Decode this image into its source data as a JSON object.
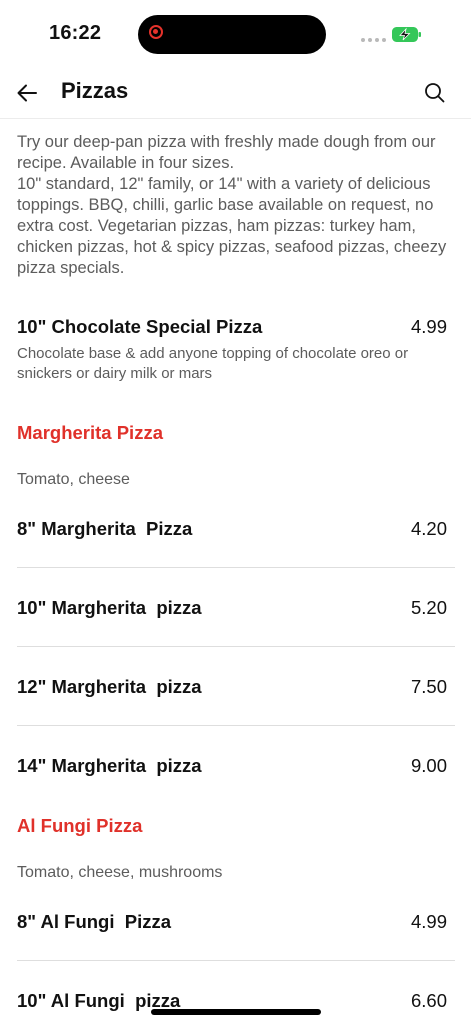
{
  "status_bar": {
    "time": "16:22"
  },
  "header": {
    "title": "Pizzas",
    "back_icon": "arrow-left-icon",
    "search_icon": "search-icon"
  },
  "intro": "Try our deep-pan pizza with freshly made dough from our recipe. Available in four sizes.\n10\" standard, 12\" family, or 14\" with a variety of delicious toppings. BBQ, chilli, garlic base available on request, no extra cost. Vegetarian pizzas, ham pizzas: turkey ham, chicken pizzas, hot & spicy pizzas, seafood pizzas, cheezy pizza specials.",
  "special": {
    "name": "10\" Chocolate Special Pizza",
    "price": "4.99",
    "description": "Chocolate base & add anyone topping of chocolate oreo or snickers or dairy milk or mars"
  },
  "sections": [
    {
      "title": "Margherita Pizza",
      "description": "Tomato, cheese",
      "items": [
        {
          "name": "8\" Margherita  Pizza",
          "price": "4.20"
        },
        {
          "name": "10\" Margherita  pizza",
          "price": "5.20"
        },
        {
          "name": "12\" Margherita  pizza",
          "price": "7.50"
        },
        {
          "name": "14\" Margherita  pizza",
          "price": "9.00"
        }
      ]
    },
    {
      "title": "Al Fungi Pizza",
      "description": "Tomato, cheese, mushrooms",
      "items": [
        {
          "name": "8\" Al Fungi  Pizza",
          "price": "4.99"
        },
        {
          "name": "10\" Al Fungi  pizza",
          "price": "6.60"
        }
      ]
    }
  ],
  "colors": {
    "accent": "#e0312a",
    "text": "#111111",
    "muted": "#5c5c5c",
    "divider": "#dedede",
    "battery": "#34c759"
  }
}
